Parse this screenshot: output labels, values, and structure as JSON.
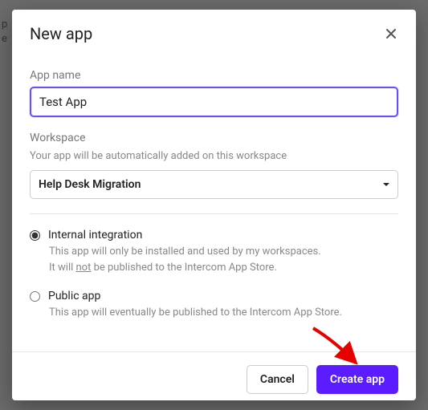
{
  "backdrop": {
    "line1": "p",
    "line2": "e"
  },
  "modal": {
    "title": "New app",
    "app_name": {
      "label": "App name",
      "value": "Test App"
    },
    "workspace": {
      "label": "Workspace",
      "hint": "Your app will be automatically added on this workspace",
      "selected": "Help Desk Migration"
    },
    "options": {
      "internal": {
        "label": "Internal integration",
        "desc_line1": "This app will only be installed and used by my workspaces.",
        "desc_prefix": "It will ",
        "desc_not": "not",
        "desc_suffix": " be published to the Intercom App Store."
      },
      "public": {
        "label": "Public app",
        "desc": "This app will eventually be published to the Intercom App Store."
      }
    },
    "buttons": {
      "cancel": "Cancel",
      "create": "Create app"
    }
  }
}
